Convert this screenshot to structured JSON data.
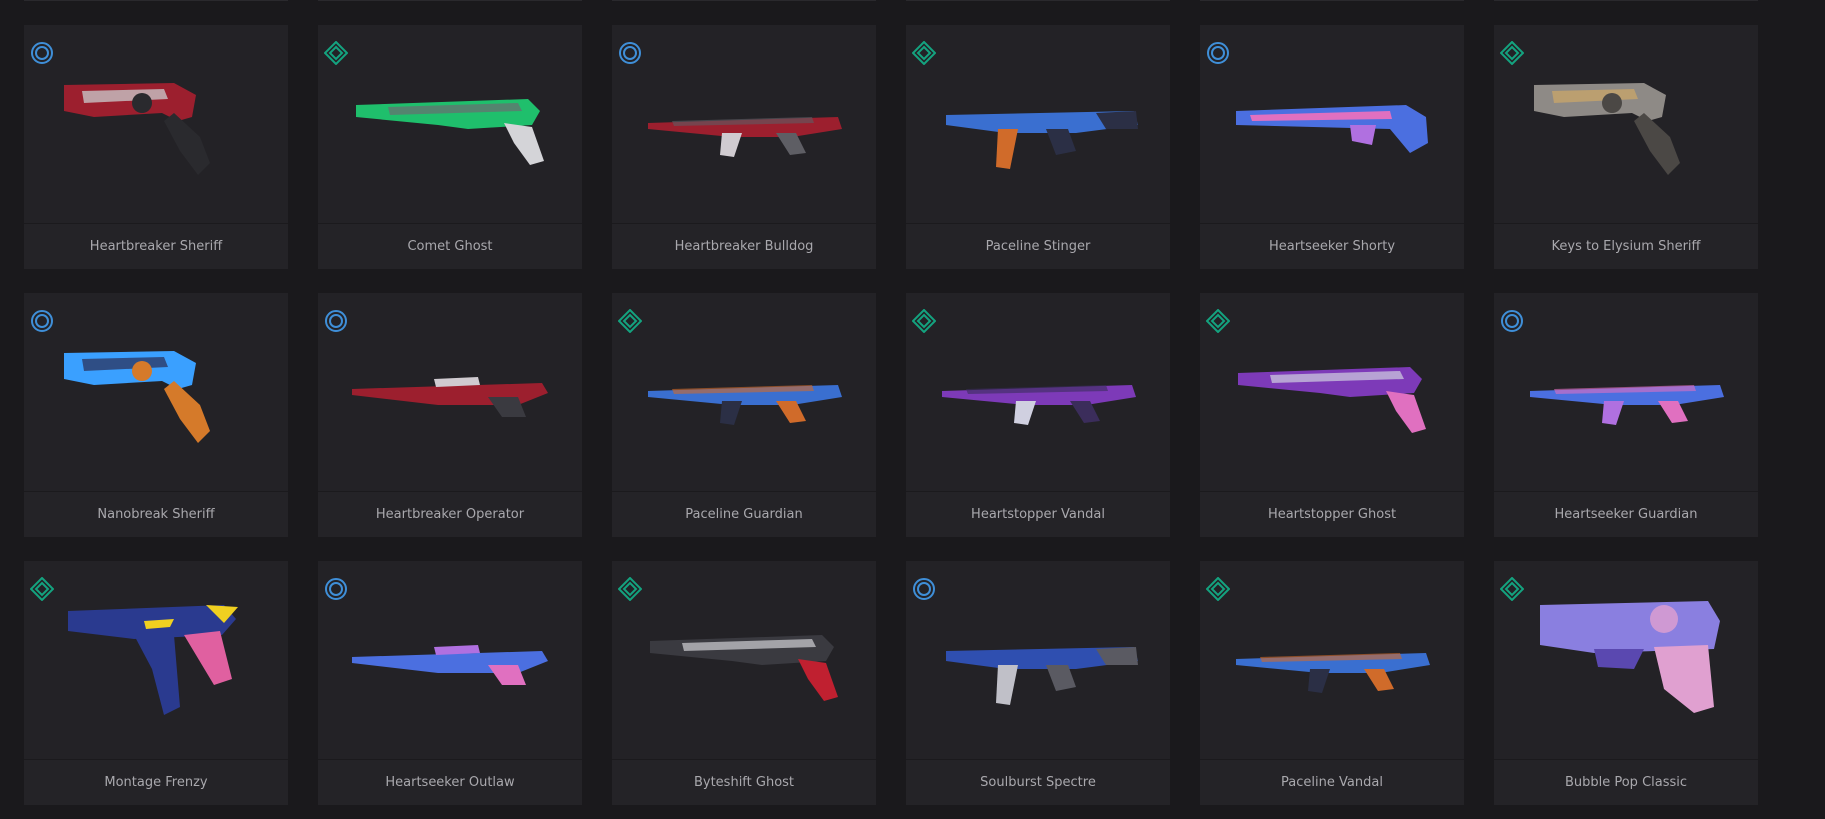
{
  "tiers": {
    "select": {
      "icon": "select-tier-icon",
      "color": "#3f8fd8"
    },
    "deluxe": {
      "icon": "deluxe-tier-icon",
      "color": "#14a37f"
    }
  },
  "skins": [
    {
      "name": "Heartbreaker Sheriff",
      "tier": "select",
      "weapon": "revolver",
      "colors": [
        "#9c1f2e",
        "#c8c3c6",
        "#2a2a2e"
      ]
    },
    {
      "name": "Comet Ghost",
      "tier": "deluxe",
      "weapon": "pistol",
      "colors": [
        "#1fbf6c",
        "#d4d4d8",
        "#6b6b70"
      ]
    },
    {
      "name": "Heartbreaker Bulldog",
      "tier": "select",
      "weapon": "rifle",
      "colors": [
        "#9c1f2e",
        "#5e5e64",
        "#d0cbd0"
      ]
    },
    {
      "name": "Paceline Stinger",
      "tier": "deluxe",
      "weapon": "smg",
      "colors": [
        "#3a6fd0",
        "#d06b2a",
        "#2b2f45"
      ]
    },
    {
      "name": "Heartseeker Shorty",
      "tier": "select",
      "weapon": "shotgun",
      "colors": [
        "#4b6fe0",
        "#e070c0",
        "#b070e0"
      ]
    },
    {
      "name": "Keys to Elysium Sheriff",
      "tier": "deluxe",
      "weapon": "revolver",
      "colors": [
        "#8e8a86",
        "#c7a46a",
        "#4b4845"
      ]
    },
    {
      "name": "Nanobreak Sheriff",
      "tier": "select",
      "weapon": "revolver",
      "colors": [
        "#3aa0ff",
        "#2d3a66",
        "#d57a2a"
      ]
    },
    {
      "name": "Heartbreaker Operator",
      "tier": "select",
      "weapon": "sniper",
      "colors": [
        "#9c1f2e",
        "#3a3a40",
        "#d0cbd0"
      ]
    },
    {
      "name": "Paceline Guardian",
      "tier": "deluxe",
      "weapon": "rifle",
      "colors": [
        "#3a6fd0",
        "#d06b2a",
        "#2b2f45"
      ]
    },
    {
      "name": "Heartstopper Vandal",
      "tier": "deluxe",
      "weapon": "rifle",
      "colors": [
        "#7d3ab8",
        "#3b2d5b",
        "#d0d0e0"
      ]
    },
    {
      "name": "Heartstopper Ghost",
      "tier": "deluxe",
      "weapon": "pistol",
      "colors": [
        "#7d3ab8",
        "#e070c0",
        "#d0d0e0"
      ]
    },
    {
      "name": "Heartseeker Guardian",
      "tier": "select",
      "weapon": "rifle",
      "colors": [
        "#4b6fe0",
        "#e070c0",
        "#b070e0"
      ]
    },
    {
      "name": "Montage Frenzy",
      "tier": "deluxe",
      "weapon": "pistol-large",
      "colors": [
        "#2a3a8f",
        "#f0d020",
        "#e060a0"
      ]
    },
    {
      "name": "Heartseeker Outlaw",
      "tier": "select",
      "weapon": "sniper",
      "colors": [
        "#4b6fe0",
        "#e070c0",
        "#b070e0"
      ]
    },
    {
      "name": "Byteshift Ghost",
      "tier": "deluxe",
      "weapon": "pistol",
      "colors": [
        "#3a3a40",
        "#c02030",
        "#d0d0d4"
      ]
    },
    {
      "name": "Soulburst Spectre",
      "tier": "select",
      "weapon": "smg",
      "colors": [
        "#2f4fb0",
        "#c0c0c8",
        "#5a5a62"
      ]
    },
    {
      "name": "Paceline Vandal",
      "tier": "deluxe",
      "weapon": "rifle",
      "colors": [
        "#3a6fd0",
        "#d06b2a",
        "#2b2f45"
      ]
    },
    {
      "name": "Bubble Pop Classic",
      "tier": "deluxe",
      "weapon": "handgun",
      "colors": [
        "#8a7fe0",
        "#e0a0d0",
        "#5a48b0"
      ]
    }
  ]
}
